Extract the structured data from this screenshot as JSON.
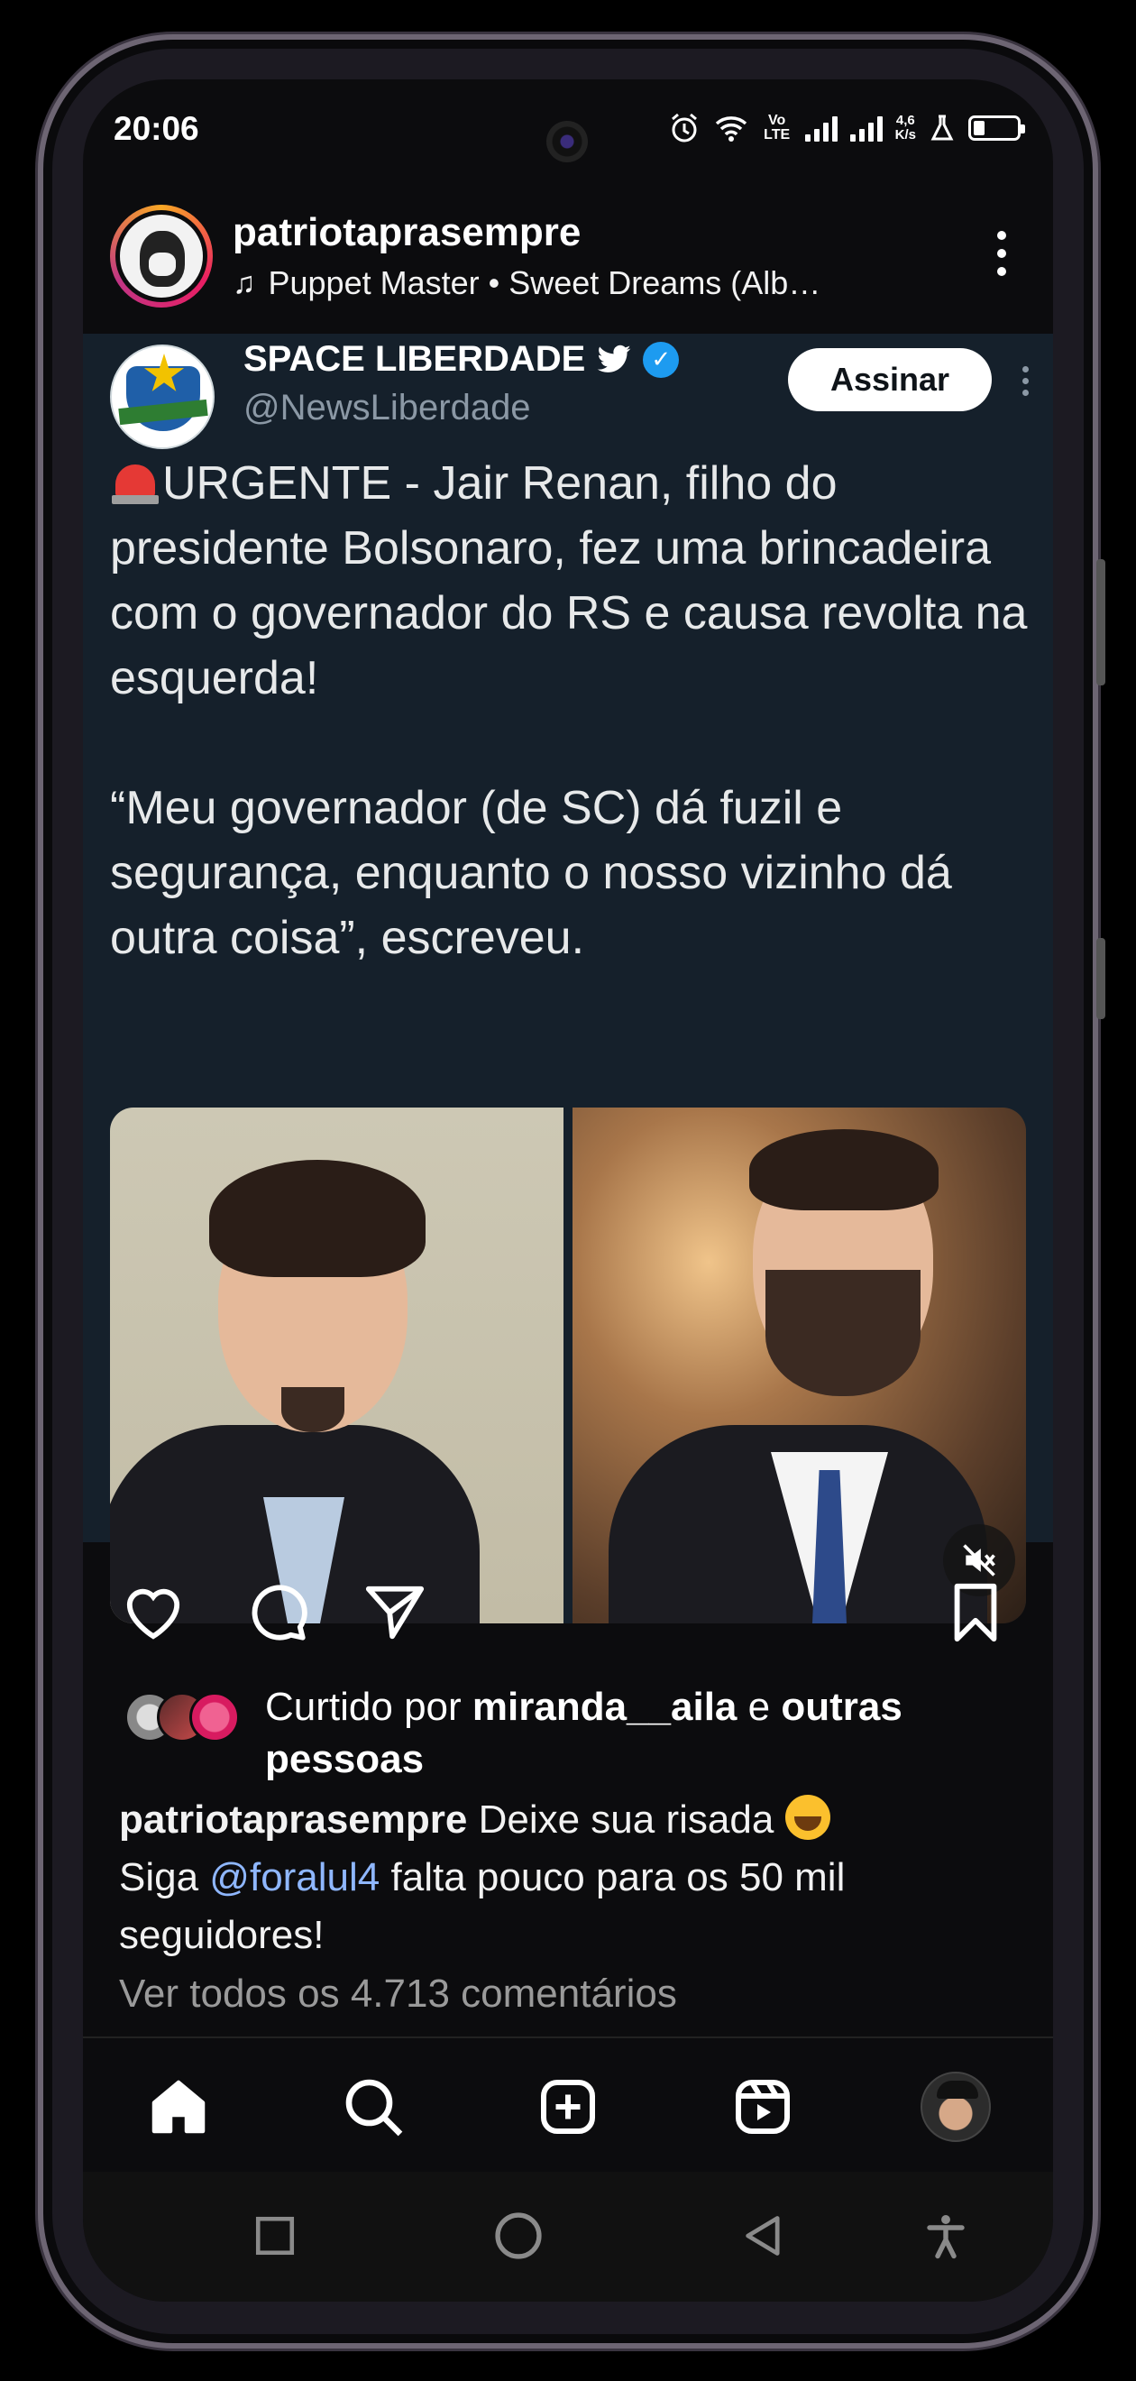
{
  "status_bar": {
    "time": "20:06",
    "volte": "Vo LTE",
    "net_speed_value": "4,6",
    "net_speed_unit": "K/s",
    "battery_level": 0.24
  },
  "post": {
    "username": "patriotaprasempre",
    "song": "Puppet Master • Sweet Dreams (Alb…"
  },
  "tweet": {
    "display_name": "SPACE LIBERDADE",
    "handle": "@NewsLiberdade",
    "subscribe_label": "Assinar",
    "paragraph_1": "URGENTE - Jair Renan, filho do presidente Bolsonaro, fez uma brincadeira com o governador do RS e causa revolta na esquerda!",
    "paragraph_2": "“Meu governador (de SC) dá fuzil e segurança, enquanto o nosso vizinho dá outra coisa”, escreveu."
  },
  "likes": {
    "prefix": "Curtido por ",
    "user": "miranda__aila",
    "connector": " e ",
    "suffix": "outras pessoas"
  },
  "caption": {
    "username": "patriotaprasempre",
    "text_1": " Deixe sua risada ",
    "line_2_prefix": "Siga ",
    "mention": "@foralul4",
    "text_2": " falta pouco para os 50 mil seguidores!"
  },
  "comments_link": "Ver todos os 4.713 comentários",
  "icons": {
    "like": "heart-icon",
    "comment": "comment-icon",
    "share": "send-icon",
    "save": "bookmark-icon",
    "home": "home-icon",
    "search": "search-icon",
    "create": "plus-square-icon",
    "reels": "reels-icon"
  },
  "colors": {
    "tweet_bg": "#15202b",
    "app_bg": "#0c0c0e",
    "mention": "#8fb7ff",
    "verified": "#1d9bf0"
  }
}
